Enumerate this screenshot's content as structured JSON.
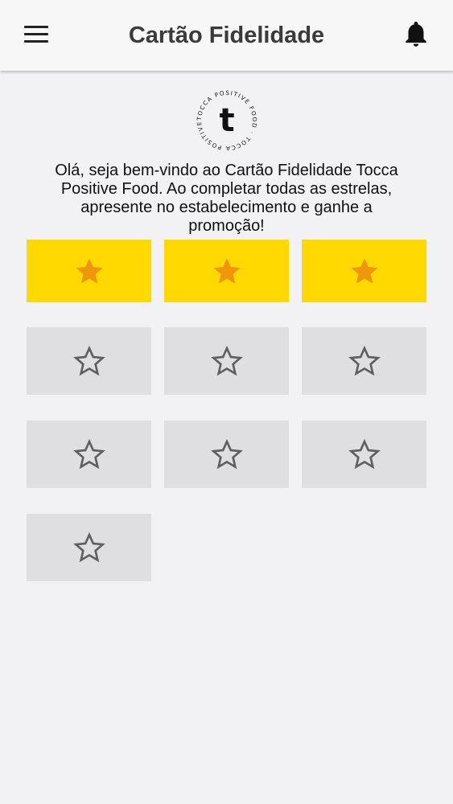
{
  "header": {
    "title": "Cartão Fidelidade"
  },
  "icons": {
    "menu": "menu-icon",
    "notifications": "bell-icon",
    "logo": "tocca-logo",
    "filled_star": "star-filled-icon",
    "empty_star": "star-outline-icon"
  },
  "logo": {
    "ring_text": "TOCCA POSITIVE FOOD · TOCCA POSITIVE FOOD ·",
    "letter": "t"
  },
  "welcome": {
    "line1": "Olá, seja bem-vindo ao Cartão Fidelidade Tocca",
    "line2": "Positive Food. Ao completar todas as estrelas,",
    "line3": "apresente no estabelecimento e ganhe a",
    "line4": "promoção!"
  },
  "loyalty": {
    "stamps": [
      true,
      true,
      true,
      false,
      false,
      false,
      false,
      false,
      false,
      false
    ],
    "filled_count": 3,
    "total": 10
  },
  "colors": {
    "filled_card": "#ffd900",
    "filled_star": "#f0960c",
    "empty_card": "#dfdfe1",
    "empty_star_stroke": "#5f5f5f",
    "background": "#f2f2f4"
  }
}
